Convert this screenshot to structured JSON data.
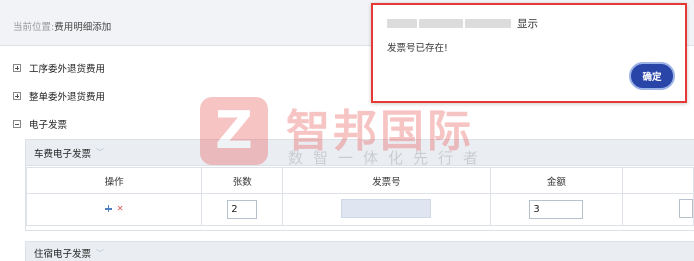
{
  "breadcrumb": {
    "prefix": "当前位置:",
    "current": "费用明细添加"
  },
  "sections": [
    {
      "label": "工序委外退货费用",
      "expanded": false
    },
    {
      "label": "整单委外退货费用",
      "expanded": false
    },
    {
      "label": "电子发票",
      "expanded": true
    }
  ],
  "vehicle_panel": {
    "title": "车费电子发票",
    "columns": [
      "操作",
      "张数",
      "发票号",
      "金额",
      ""
    ],
    "row": {
      "count": "2",
      "invoice_no": "",
      "amount": "3"
    }
  },
  "lodging_panel": {
    "title": "住宿电子发票"
  },
  "dialog": {
    "title_suffix": "显示",
    "message": "发票号已存在!",
    "ok_label": "确定"
  },
  "watermark": {
    "title": "智邦国际",
    "subtitle": "数智一体化先行者"
  },
  "colors": {
    "dialog_border": "#e53935",
    "ok_button": "#2a45a8",
    "panel_header": "#eaeef3"
  },
  "icons": {
    "toggle_collapsed": "plus-box-icon",
    "toggle_expanded": "minus-box-icon",
    "panel_chevron": "chevron-down-icon",
    "row_add": "plus-icon",
    "row_delete": "x-icon"
  }
}
